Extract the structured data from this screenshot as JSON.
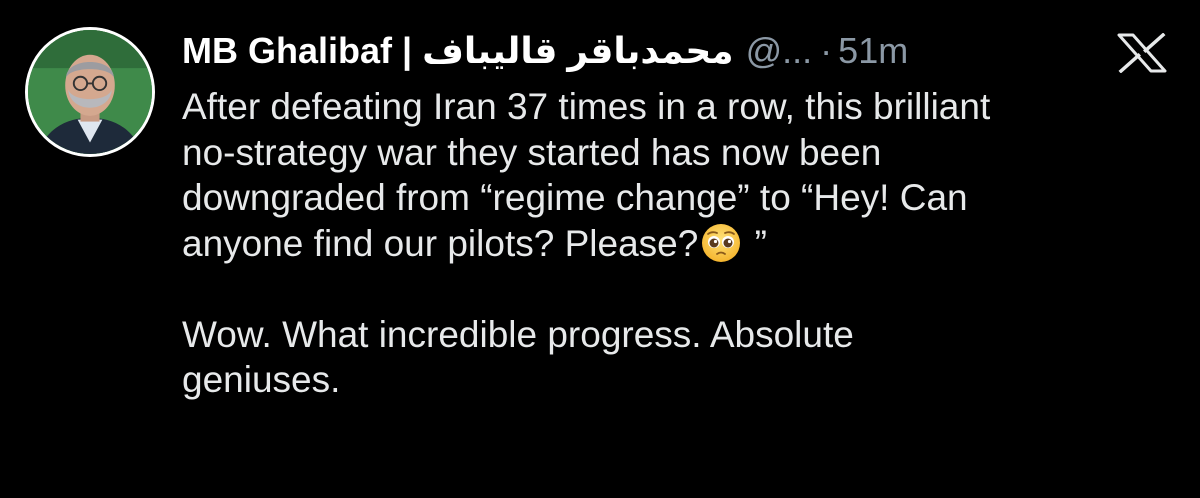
{
  "author": {
    "display_name": "MB Ghalibaf | محمدباقر قالیباف",
    "handle": "@...",
    "separator": "·",
    "time": "51m",
    "avatar_icon": "profile-photo"
  },
  "app": {
    "logo_icon": "x-logo-icon"
  },
  "tweet": {
    "line1": "After defeating Iran 37 times in a row, this brilliant",
    "line2": "no-strategy war they started has now been",
    "line3": "downgraded from “regime change” to “Hey! Can",
    "line4_pre": "anyone find our pilots? Please?",
    "line4_post": " ”",
    "emoji_icon": "pleading-face-emoji",
    "line5": "Wow. What incredible progress. Absolute",
    "line6": "geniuses."
  },
  "colors": {
    "background": "#000000",
    "text": "#e7e9ea",
    "secondary": "#8b98a5"
  }
}
